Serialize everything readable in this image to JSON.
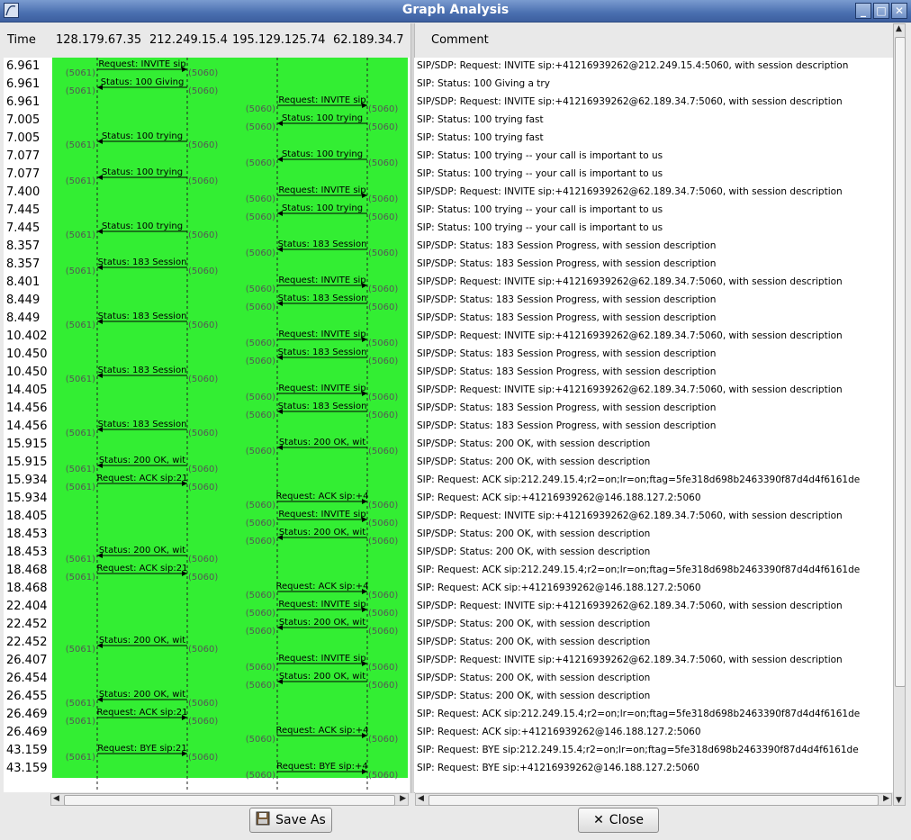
{
  "window": {
    "title": "Graph Analysis"
  },
  "header": {
    "time": "Time",
    "nodes": [
      "128.179.67.35",
      "212.249.15.4",
      "195.129.125.74",
      "62.189.34.7"
    ],
    "comment": "Comment"
  },
  "rows": [
    {
      "t": "6.961",
      "m": "Request: INVITE sip",
      "c": "SIP/SDP: Request: INVITE sip:+41216939262@212.249.15.4:5060, with session description",
      "f": 0,
      "to": 1,
      "pl": "(5061)",
      "pr": "(5060)"
    },
    {
      "t": "6.961",
      "m": "Status: 100 Giving",
      "c": "SIP: Status: 100 Giving a try",
      "f": 1,
      "to": 0,
      "pl": "(5061)",
      "pr": "(5060)"
    },
    {
      "t": "6.961",
      "m": "Request: INVITE sip",
      "c": "SIP/SDP: Request: INVITE sip:+41216939262@62.189.34.7:5060, with session description",
      "f": 2,
      "to": 3,
      "pl": "(5060)",
      "pr": "(5060)"
    },
    {
      "t": "7.005",
      "m": "Status: 100 trying",
      "c": "SIP: Status: 100 trying fast",
      "f": 3,
      "to": 2,
      "pl": "(5060)",
      "pr": "(5060)"
    },
    {
      "t": "7.005",
      "m": "Status: 100 trying",
      "c": "SIP: Status: 100 trying fast",
      "f": 1,
      "to": 0,
      "pl": "(5061)",
      "pr": "(5060)"
    },
    {
      "t": "7.077",
      "m": "Status: 100 trying",
      "c": "SIP: Status: 100 trying -- your call is important to us",
      "f": 3,
      "to": 2,
      "pl": "(5060)",
      "pr": "(5060)"
    },
    {
      "t": "7.077",
      "m": "Status: 100 trying",
      "c": "SIP: Status: 100 trying -- your call is important to us",
      "f": 1,
      "to": 0,
      "pl": "(5061)",
      "pr": "(5060)"
    },
    {
      "t": "7.400",
      "m": "Request: INVITE sip",
      "c": "SIP/SDP: Request: INVITE sip:+41216939262@62.189.34.7:5060, with session description",
      "f": 2,
      "to": 3,
      "pl": "(5060)",
      "pr": "(5060)"
    },
    {
      "t": "7.445",
      "m": "Status: 100 trying",
      "c": "SIP: Status: 100 trying -- your call is important to us",
      "f": 3,
      "to": 2,
      "pl": "(5060)",
      "pr": "(5060)"
    },
    {
      "t": "7.445",
      "m": "Status: 100 trying",
      "c": "SIP: Status: 100 trying -- your call is important to us",
      "f": 1,
      "to": 0,
      "pl": "(5061)",
      "pr": "(5060)"
    },
    {
      "t": "8.357",
      "m": "Status: 183 Session",
      "c": "SIP/SDP: Status: 183 Session Progress, with session description",
      "f": 3,
      "to": 2,
      "pl": "(5060)",
      "pr": "(5060)"
    },
    {
      "t": "8.357",
      "m": "Status: 183 Session",
      "c": "SIP/SDP: Status: 183 Session Progress, with session description",
      "f": 1,
      "to": 0,
      "pl": "(5061)",
      "pr": "(5060)"
    },
    {
      "t": "8.401",
      "m": "Request: INVITE sip",
      "c": "SIP/SDP: Request: INVITE sip:+41216939262@62.189.34.7:5060, with session description",
      "f": 2,
      "to": 3,
      "pl": "(5060)",
      "pr": "(5060)"
    },
    {
      "t": "8.449",
      "m": "Status: 183 Session",
      "c": "SIP/SDP: Status: 183 Session Progress, with session description",
      "f": 3,
      "to": 2,
      "pl": "(5060)",
      "pr": "(5060)"
    },
    {
      "t": "8.449",
      "m": "Status: 183 Session",
      "c": "SIP/SDP: Status: 183 Session Progress, with session description",
      "f": 1,
      "to": 0,
      "pl": "(5061)",
      "pr": "(5060)"
    },
    {
      "t": "10.402",
      "m": "Request: INVITE sip",
      "c": "SIP/SDP: Request: INVITE sip:+41216939262@62.189.34.7:5060, with session description",
      "f": 2,
      "to": 3,
      "pl": "(5060)",
      "pr": "(5060)"
    },
    {
      "t": "10.450",
      "m": "Status: 183 Session",
      "c": "SIP/SDP: Status: 183 Session Progress, with session description",
      "f": 3,
      "to": 2,
      "pl": "(5060)",
      "pr": "(5060)"
    },
    {
      "t": "10.450",
      "m": "Status: 183 Session",
      "c": "SIP/SDP: Status: 183 Session Progress, with session description",
      "f": 1,
      "to": 0,
      "pl": "(5061)",
      "pr": "(5060)"
    },
    {
      "t": "14.405",
      "m": "Request: INVITE sip",
      "c": "SIP/SDP: Request: INVITE sip:+41216939262@62.189.34.7:5060, with session description",
      "f": 2,
      "to": 3,
      "pl": "(5060)",
      "pr": "(5060)"
    },
    {
      "t": "14.456",
      "m": "Status: 183 Session",
      "c": "SIP/SDP: Status: 183 Session Progress, with session description",
      "f": 3,
      "to": 2,
      "pl": "(5060)",
      "pr": "(5060)"
    },
    {
      "t": "14.456",
      "m": "Status: 183 Session",
      "c": "SIP/SDP: Status: 183 Session Progress, with session description",
      "f": 1,
      "to": 0,
      "pl": "(5061)",
      "pr": "(5060)"
    },
    {
      "t": "15.915",
      "m": "Status: 200 OK, wit",
      "c": "SIP/SDP: Status: 200 OK, with session description",
      "f": 3,
      "to": 2,
      "pl": "(5060)",
      "pr": "(5060)"
    },
    {
      "t": "15.915",
      "m": "Status: 200 OK, wit",
      "c": "SIP/SDP: Status: 200 OK, with session description",
      "f": 1,
      "to": 0,
      "pl": "(5061)",
      "pr": "(5060)"
    },
    {
      "t": "15.934",
      "m": "Request: ACK sip:21",
      "c": "SIP: Request: ACK sip:212.249.15.4;r2=on;lr=on;ftag=5fe318d698b2463390f87d4d4f6161de",
      "f": 0,
      "to": 1,
      "pl": "(5061)",
      "pr": "(5060)"
    },
    {
      "t": "15.934",
      "m": "Request: ACK sip:+4",
      "c": "SIP: Request: ACK sip:+41216939262@146.188.127.2:5060",
      "f": 2,
      "to": 3,
      "pl": "(5060)",
      "pr": "(5060)"
    },
    {
      "t": "18.405",
      "m": "Request: INVITE sip",
      "c": "SIP/SDP: Request: INVITE sip:+41216939262@62.189.34.7:5060, with session description",
      "f": 2,
      "to": 3,
      "pl": "(5060)",
      "pr": "(5060)"
    },
    {
      "t": "18.453",
      "m": "Status: 200 OK, wit",
      "c": "SIP/SDP: Status: 200 OK, with session description",
      "f": 3,
      "to": 2,
      "pl": "(5060)",
      "pr": "(5060)"
    },
    {
      "t": "18.453",
      "m": "Status: 200 OK, wit",
      "c": "SIP/SDP: Status: 200 OK, with session description",
      "f": 1,
      "to": 0,
      "pl": "(5061)",
      "pr": "(5060)"
    },
    {
      "t": "18.468",
      "m": "Request: ACK sip:21",
      "c": "SIP: Request: ACK sip:212.249.15.4;r2=on;lr=on;ftag=5fe318d698b2463390f87d4d4f6161de",
      "f": 0,
      "to": 1,
      "pl": "(5061)",
      "pr": "(5060)"
    },
    {
      "t": "18.468",
      "m": "Request: ACK sip:+4",
      "c": "SIP: Request: ACK sip:+41216939262@146.188.127.2:5060",
      "f": 2,
      "to": 3,
      "pl": "(5060)",
      "pr": "(5060)"
    },
    {
      "t": "22.404",
      "m": "Request: INVITE sip",
      "c": "SIP/SDP: Request: INVITE sip:+41216939262@62.189.34.7:5060, with session description",
      "f": 2,
      "to": 3,
      "pl": "(5060)",
      "pr": "(5060)"
    },
    {
      "t": "22.452",
      "m": "Status: 200 OK, wit",
      "c": "SIP/SDP: Status: 200 OK, with session description",
      "f": 3,
      "to": 2,
      "pl": "(5060)",
      "pr": "(5060)"
    },
    {
      "t": "22.452",
      "m": "Status: 200 OK, wit",
      "c": "SIP/SDP: Status: 200 OK, with session description",
      "f": 1,
      "to": 0,
      "pl": "(5061)",
      "pr": "(5060)"
    },
    {
      "t": "26.407",
      "m": "Request: INVITE sip",
      "c": "SIP/SDP: Request: INVITE sip:+41216939262@62.189.34.7:5060, with session description",
      "f": 2,
      "to": 3,
      "pl": "(5060)",
      "pr": "(5060)"
    },
    {
      "t": "26.454",
      "m": "Status: 200 OK, wit",
      "c": "SIP/SDP: Status: 200 OK, with session description",
      "f": 3,
      "to": 2,
      "pl": "(5060)",
      "pr": "(5060)"
    },
    {
      "t": "26.455",
      "m": "Status: 200 OK, wit",
      "c": "SIP/SDP: Status: 200 OK, with session description",
      "f": 1,
      "to": 0,
      "pl": "(5061)",
      "pr": "(5060)"
    },
    {
      "t": "26.469",
      "m": "Request: ACK sip:21",
      "c": "SIP: Request: ACK sip:212.249.15.4;r2=on;lr=on;ftag=5fe318d698b2463390f87d4d4f6161de",
      "f": 0,
      "to": 1,
      "pl": "(5061)",
      "pr": "(5060)"
    },
    {
      "t": "26.469",
      "m": "Request: ACK sip:+4",
      "c": "SIP: Request: ACK sip:+41216939262@146.188.127.2:5060",
      "f": 2,
      "to": 3,
      "pl": "(5060)",
      "pr": "(5060)"
    },
    {
      "t": "43.159",
      "m": "Request: BYE sip:21",
      "c": "SIP: Request: BYE sip:212.249.15.4;r2=on;lr=on;ftag=5fe318d698b2463390f87d4d4f6161de",
      "f": 0,
      "to": 1,
      "pl": "(5061)",
      "pr": "(5060)"
    },
    {
      "t": "43.159",
      "m": "Request: BYE sip:+4",
      "c": "SIP: Request: BYE sip:+41216939262@146.188.127.2:5060",
      "f": 2,
      "to": 3,
      "pl": "(5060)",
      "pr": "(5060)"
    }
  ],
  "buttons": {
    "save_as": "Save As",
    "close": "Close"
  },
  "icons": {
    "save": "floppy-disk-icon",
    "close": "x-icon",
    "app": "graph-icon"
  },
  "colors": {
    "graph_bg": "#33ee33",
    "titlebar": "#4a6fb0"
  }
}
